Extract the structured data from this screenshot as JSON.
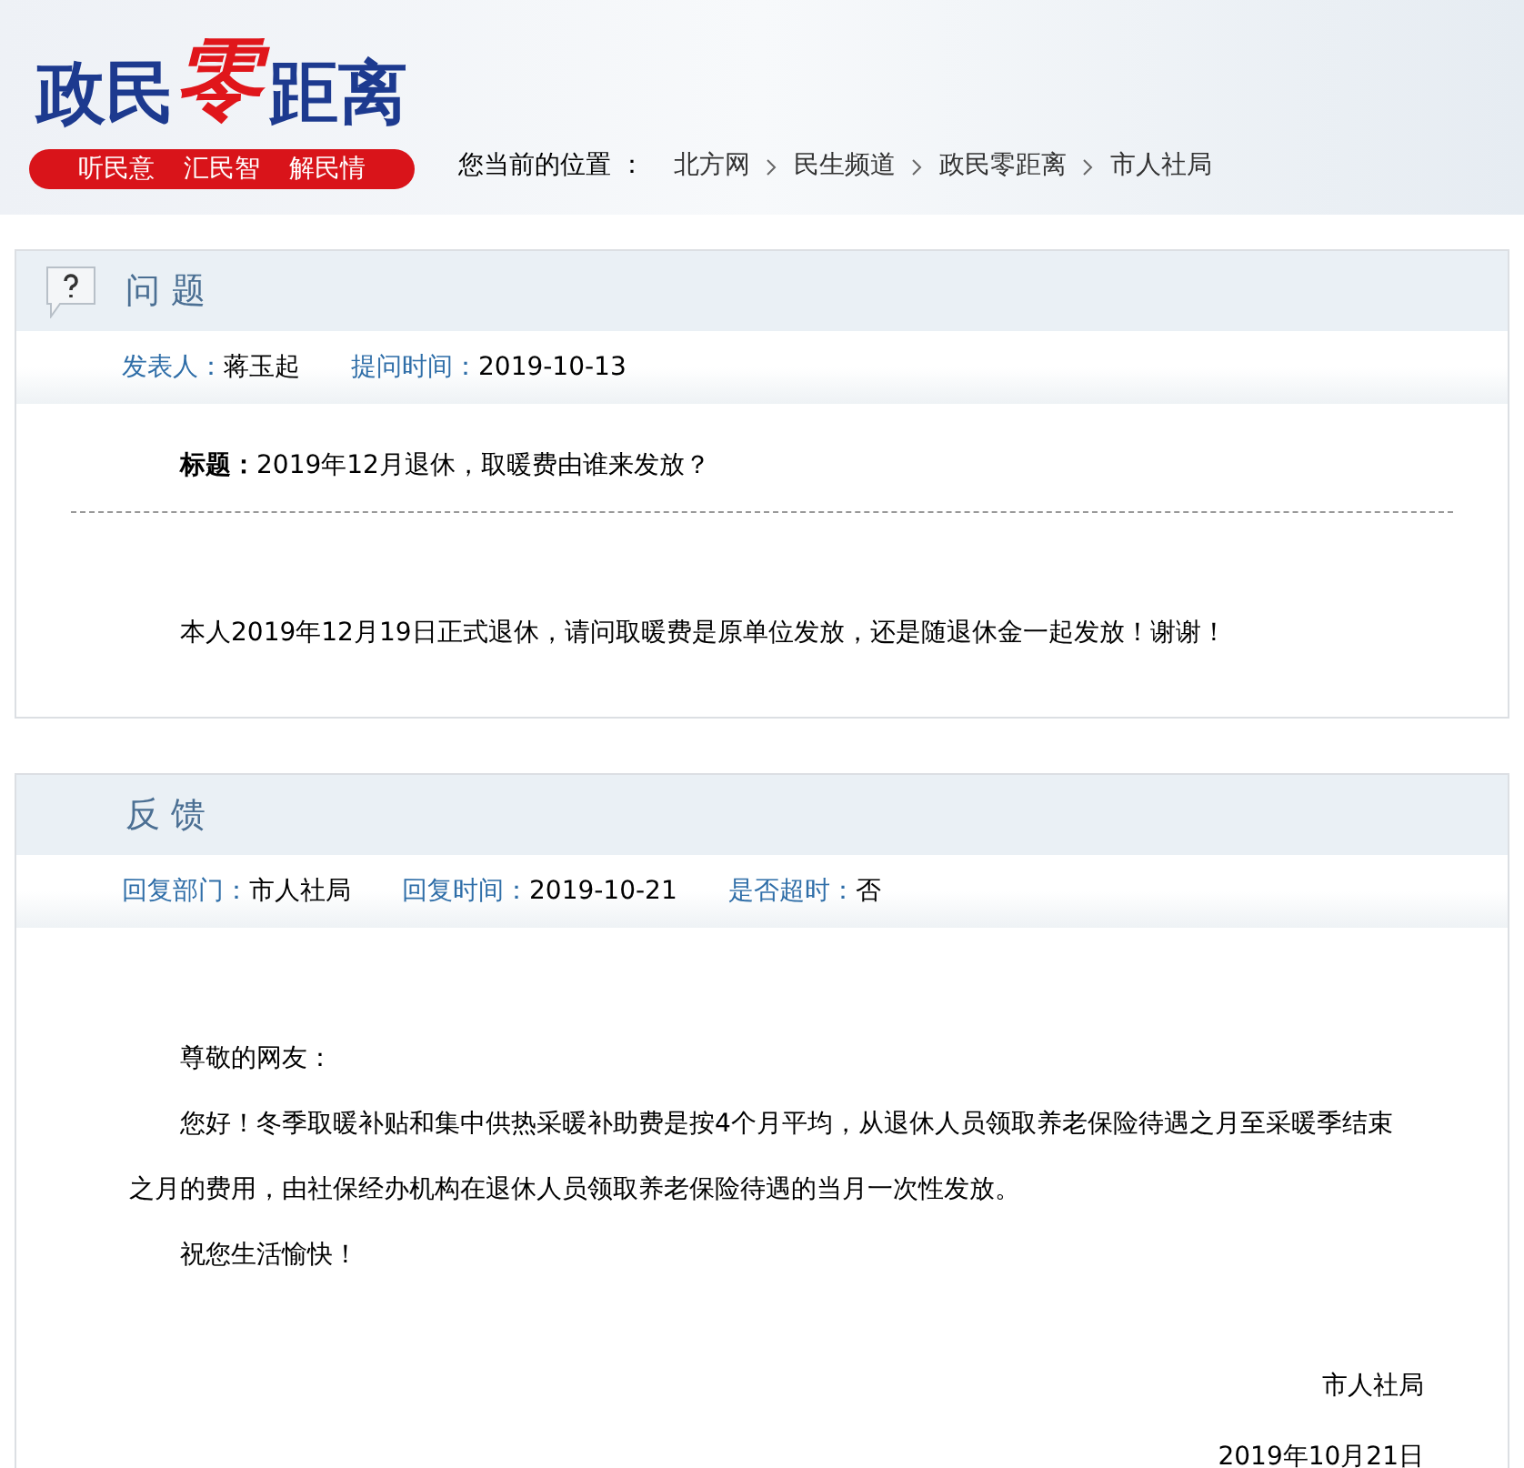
{
  "header": {
    "logo": [
      {
        "kind": "plain",
        "text": "政民"
      },
      {
        "kind": "accent",
        "text": "零"
      },
      {
        "kind": "plain",
        "text": "距离"
      }
    ],
    "slogans": [
      "听民意",
      "汇民智",
      "解民情"
    ],
    "breadcrumb": {
      "label": "您当前的位置 ：",
      "items": [
        "北方网",
        "民生频道",
        "政民零距离",
        "市人社局"
      ]
    }
  },
  "sections": [
    {
      "kind": "question",
      "title": "问 题",
      "meta": [
        {
          "label": "发表人：",
          "value": "蒋玉起"
        },
        {
          "label": "提问时间：",
          "value": "2019-10-13"
        }
      ],
      "subject": {
        "label": "标题：",
        "value": "2019年12月退休，取暖费由谁来发放？"
      },
      "paragraphs": [
        "本人2019年12月19日正式退休，请问取暖费是原单位发放，还是随退休金一起发放！谢谢！"
      ]
    },
    {
      "kind": "reply",
      "title": "反 馈",
      "meta": [
        {
          "label": "回复部门：",
          "value": "市人社局"
        },
        {
          "label": "回复时间：",
          "value": "2019-10-21"
        },
        {
          "label": "是否超时：",
          "value": "否"
        }
      ],
      "paragraphs": [
        "尊敬的网友：",
        "您好！冬季取暖补贴和集中供热采暖补助费是按4个月平均，从退休人员领取养老保险待遇之月至采暖季结束之月的费用，由社保经办机构在退休人员领取养老保险待遇的当月一次性发放。",
        "祝您生活愉快！"
      ],
      "signature": [
        "市人社局",
        "2019年10月21日"
      ]
    }
  ]
}
